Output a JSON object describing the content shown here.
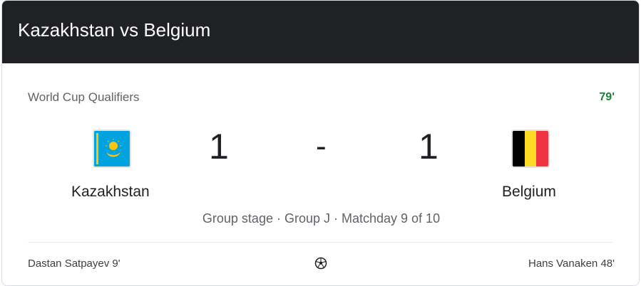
{
  "header": {
    "title": "Kazakhstan vs Belgium"
  },
  "match": {
    "competition": "World Cup Qualifiers",
    "minute": "79'",
    "stage": "Group stage · Group J · Matchday 9 of 10",
    "home": {
      "name": "Kazakhstan",
      "score": "1",
      "flag_icon": "kazakhstan-flag-icon"
    },
    "away": {
      "name": "Belgium",
      "score": "1",
      "flag_icon": "belgium-flag-icon"
    },
    "separator": "-"
  },
  "goals": {
    "home_scorer": "Dastan Satpayev 9'",
    "away_scorer": "Hans Vanaken 48'",
    "icon": "soccer-ball-icon"
  },
  "colors": {
    "header_bg": "#202124",
    "live_minute": "#188038",
    "kazakhstan_blue": "#00a3dd",
    "kazakhstan_gold": "#fec50c",
    "belgium_black": "#000000",
    "belgium_yellow": "#fdda24",
    "belgium_red": "#ef3340"
  }
}
